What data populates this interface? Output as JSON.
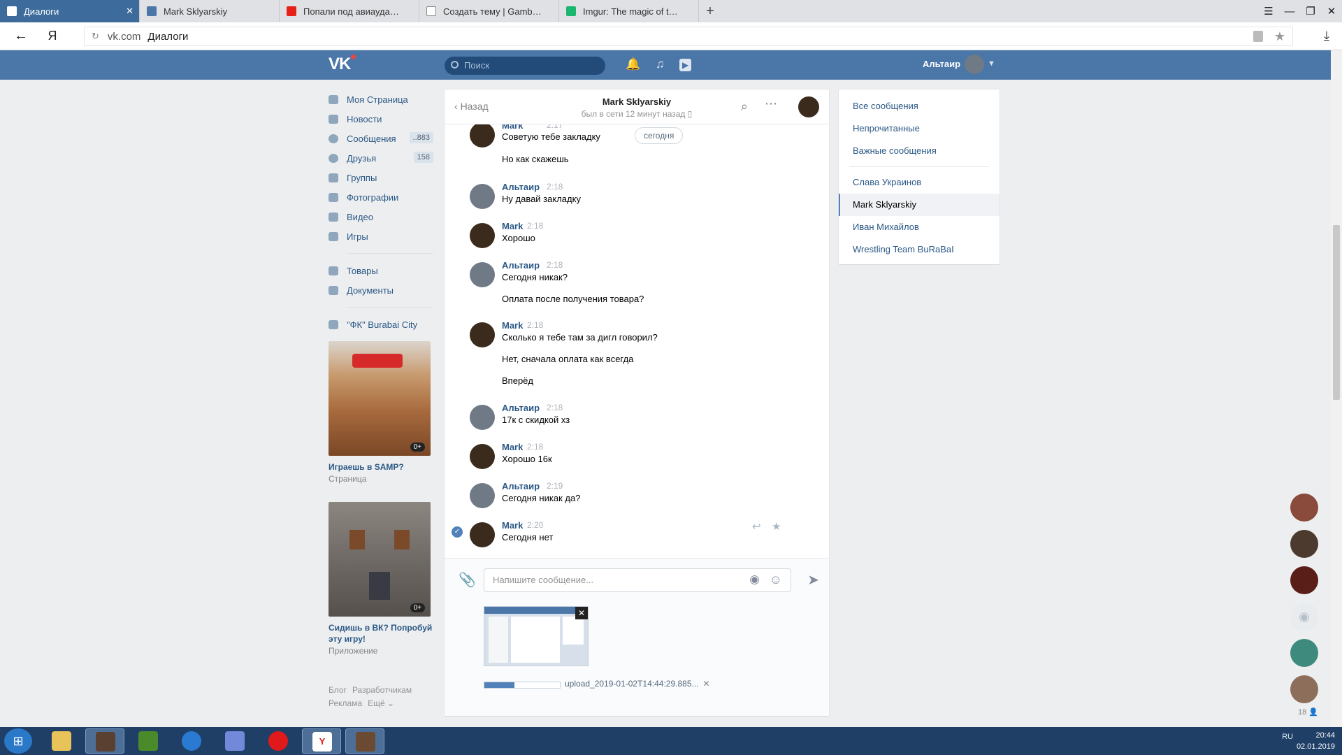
{
  "browser": {
    "tabs": [
      {
        "label": "Диалоги",
        "active": true
      },
      {
        "label": "Mark Sklyarskiy",
        "active": false
      },
      {
        "label": "Попали под авиаудар [ARMA",
        "active": false
      },
      {
        "label": "Создать тему | Gambit Role",
        "active": false
      },
      {
        "label": "Imgur: The magic of the Inte",
        "active": false
      }
    ],
    "new_tab": "+",
    "yandex_logo": "Я",
    "address": {
      "domain": "vk.com",
      "path": "Диалоги"
    }
  },
  "vk_header": {
    "logo": "VK",
    "search_placeholder": "Поиск",
    "user_name": "Альтаир"
  },
  "left_menu": {
    "items": [
      {
        "label": "Моя Страница",
        "icon": "home-icon"
      },
      {
        "label": "Новости",
        "icon": "news-icon"
      },
      {
        "label": "Сообщения",
        "icon": "messages-icon",
        "badge": "..883"
      },
      {
        "label": "Друзья",
        "icon": "friends-icon",
        "badge": "158"
      },
      {
        "label": "Группы",
        "icon": "groups-icon"
      },
      {
        "label": "Фотографии",
        "icon": "photos-icon"
      },
      {
        "label": "Видео",
        "icon": "video-icon"
      },
      {
        "label": "Игры",
        "icon": "games-icon"
      }
    ],
    "items2": [
      {
        "label": "Товары",
        "icon": "goods-icon"
      },
      {
        "label": "Документы",
        "icon": "documents-icon"
      }
    ],
    "group": {
      "label": "\"ФК\" Burabai City",
      "icon": "group-icon"
    },
    "promos": [
      {
        "title": "Играешь в SAMP?",
        "sub": "Страница",
        "age": "0+"
      },
      {
        "title": "Сидишь в ВК? Попробуй эту игру!",
        "sub": "Приложение",
        "age": "0+"
      }
    ],
    "footer": [
      "Блог",
      "Разработчикам",
      "Реклама",
      "Ещё ⌄"
    ]
  },
  "chat": {
    "back_label": "Назад",
    "contact_name": "Mark Sklyarskiy",
    "status": "был в сети 12 минут назад",
    "date_chip": "сегодня",
    "messages": [
      {
        "author": "Mark",
        "time": "2:17",
        "lines": [
          "Советую тебе закладку",
          "Но как скажешь"
        ],
        "avatar": "mark"
      },
      {
        "author": "Альтаир",
        "time": "2:18",
        "lines": [
          "Ну давай закладку"
        ],
        "avatar": "altair"
      },
      {
        "author": "Mark",
        "time": "2:18",
        "lines": [
          "Хорошо"
        ],
        "avatar": "mark"
      },
      {
        "author": "Альтаир",
        "time": "2:18",
        "lines": [
          "Сегодня никак?",
          "Оплата после получения товара?"
        ],
        "avatar": "altair"
      },
      {
        "author": "Mark",
        "time": "2:18",
        "lines": [
          "Сколько я тебе там за дигл говорил?",
          "Нет, сначала оплата как всегда",
          "Вперёд"
        ],
        "avatar": "mark"
      },
      {
        "author": "Альтаир",
        "time": "2:18",
        "lines": [
          "17к с скидкой хз"
        ],
        "avatar": "altair"
      },
      {
        "author": "Mark",
        "time": "2:18",
        "lines": [
          "Хорошо 16к"
        ],
        "avatar": "mark"
      },
      {
        "author": "Альтаир",
        "time": "2:19",
        "lines": [
          "Сегодня никак да?"
        ],
        "avatar": "altair"
      },
      {
        "author": "Mark",
        "time": "2:20",
        "lines": [
          "Сегодня нет"
        ],
        "avatar": "mark",
        "selected": true
      }
    ],
    "composer_placeholder": "Напишите сообщение...",
    "upload": {
      "filename": "upload_2019-01-02T14:44:29.885...",
      "progress": 0.4
    }
  },
  "right_panel": {
    "filters": [
      "Все сообщения",
      "Непрочитанные",
      "Важные сообщения"
    ],
    "dialogs": [
      {
        "name": "Слава Украинов",
        "selected": false
      },
      {
        "name": "Mark Sklyarskiy",
        "selected": true
      },
      {
        "name": "Иван Михайлов",
        "selected": false
      },
      {
        "name": "Wrestling Team BuRaBaI",
        "selected": false
      }
    ]
  },
  "side_panel": {
    "friends_count": "18"
  },
  "taskbar": {
    "lang": "RU",
    "time": "20:44",
    "date": "02.01.2019"
  },
  "colors": {
    "vk_blue": "#4a76a8",
    "link": "#2a5885",
    "taskbar": "#1f3f66"
  }
}
